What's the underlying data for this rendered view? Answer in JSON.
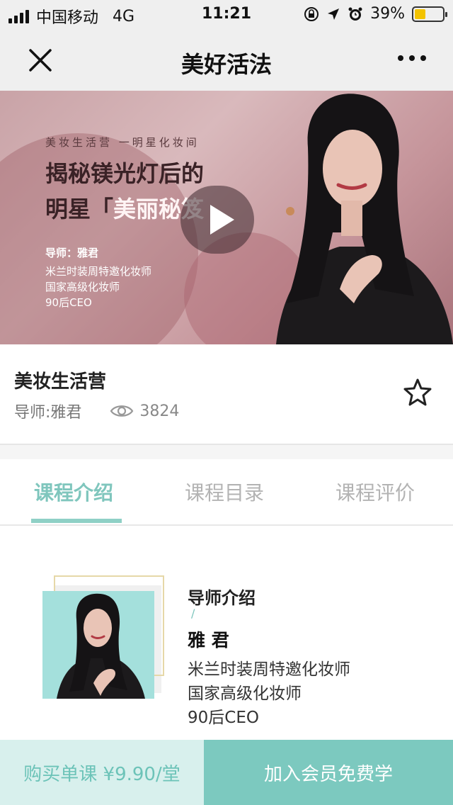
{
  "status_bar": {
    "carrier": "中国移动",
    "network": "4G",
    "time": "11:21",
    "battery_percent": "39%",
    "battery_level": 0.39,
    "battery_color": "#f3c300"
  },
  "nav": {
    "title": "美好活法",
    "close_icon": "close-icon",
    "more_icon": "more-icon"
  },
  "video": {
    "kicker": "美妆生活营 一明星化妆间",
    "headline_line1": "揭秘镁光灯后的",
    "headline_line2_prefix": "明星「",
    "headline_highlight": "美丽秘笈",
    "mentor": "导师：雅君",
    "details": [
      "米兰时装周特邀化妆师",
      "国家高级化妆师",
      "90后CEO"
    ]
  },
  "course": {
    "title": "美妆生活营",
    "mentor": "导师:雅君",
    "views": "3824"
  },
  "tabs": [
    {
      "label": "课程介绍",
      "active": true
    },
    {
      "label": "课程目录",
      "active": false
    },
    {
      "label": "课程评价",
      "active": false
    }
  ],
  "intro": {
    "section_label": "导师介绍",
    "slash": "/",
    "name": "雅 君",
    "lines": [
      "米兰时装周特邀化妆师",
      "国家高级化妆师",
      "90后CEO"
    ]
  },
  "actions": {
    "buy_label": "购买单课 ¥9.90/堂",
    "join_label": "加入会员免费学"
  },
  "colors": {
    "accent": "#7cc9bf",
    "accent_light": "#d8f0ed"
  }
}
